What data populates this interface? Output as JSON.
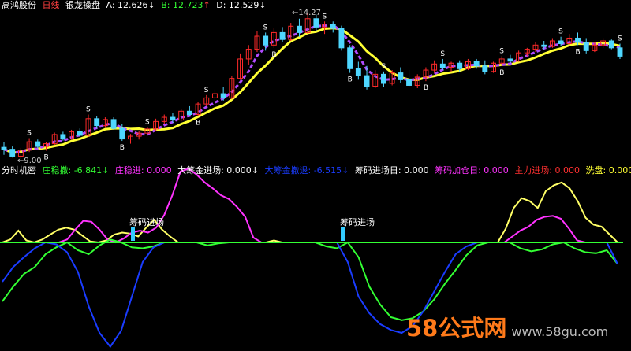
{
  "header": {
    "stock": "高鸿股份",
    "period": "日线",
    "indicator": "银龙操盘",
    "a_label": "A: 12.626",
    "a_arrow": "↓",
    "b_label": "B: 12.723",
    "b_arrow": "↑",
    "d_label": "D: 12.529",
    "d_arrow": "↓"
  },
  "annotations": {
    "high": "14.27",
    "low": "9.00",
    "sell": "S",
    "buy": "B"
  },
  "sub_header": {
    "name": "分时机密",
    "f1": "庄稳撤: -6.841",
    "f1_arrow": "↓",
    "f2": "庄稳进: 0.000",
    "f3": "大筹金进场: 0.000",
    "f3_arrow": "↓",
    "f4": "大筹金撤退: -6.515",
    "f4_arrow": "↓",
    "f5": "筹码进场日: 0.000",
    "f6": "筹码加仓日: 0.000",
    "f7": "主力进场: 0.000",
    "f8": "洗盘: 0.000",
    "f8_arrow": "↓"
  },
  "marker_label": "筹码进场",
  "watermark": {
    "big": "58公式网",
    "url": "www.58gu.com"
  },
  "colors": {
    "up": "#ff2a2a",
    "down": "#4fd7ff",
    "ma": "#ffff33",
    "purple": "#b04bff",
    "green": "#33ff33",
    "magenta": "#ff33ff",
    "yellow": "#ffff66",
    "blue": "#1a3cff",
    "cyan": "#33ccff"
  },
  "chart_data": [
    {
      "type": "candlestick",
      "title": "银龙操盘",
      "y_range": [
        9.0,
        14.27
      ],
      "labeled_high": 14.27,
      "labeled_low": 9.0,
      "candles": [
        [
          9.42,
          9.6,
          9.15,
          9.35
        ],
        [
          9.35,
          9.45,
          9.05,
          9.1
        ],
        [
          9.1,
          9.4,
          9.0,
          9.32
        ],
        [
          9.32,
          9.75,
          9.25,
          9.62
        ],
        [
          9.62,
          9.7,
          9.38,
          9.45
        ],
        [
          9.45,
          9.62,
          9.3,
          9.55
        ],
        [
          9.55,
          9.95,
          9.5,
          9.88
        ],
        [
          9.88,
          9.98,
          9.66,
          9.72
        ],
        [
          9.72,
          10.05,
          9.7,
          9.98
        ],
        [
          9.98,
          10.1,
          9.8,
          9.85
        ],
        [
          9.85,
          10.6,
          9.8,
          10.45
        ],
        [
          10.45,
          10.55,
          10.1,
          10.2
        ],
        [
          10.2,
          10.5,
          10.12,
          10.42
        ],
        [
          10.42,
          10.5,
          10.05,
          10.1
        ],
        [
          10.1,
          10.25,
          9.65,
          9.72
        ],
        [
          9.72,
          9.9,
          9.55,
          9.82
        ],
        [
          9.82,
          10.02,
          9.7,
          9.93
        ],
        [
          9.93,
          10.15,
          9.85,
          10.08
        ],
        [
          10.08,
          10.45,
          10.0,
          10.35
        ],
        [
          10.35,
          10.6,
          10.25,
          10.5
        ],
        [
          10.5,
          10.65,
          10.3,
          10.4
        ],
        [
          10.4,
          10.8,
          10.35,
          10.72
        ],
        [
          10.72,
          10.9,
          10.55,
          10.6
        ],
        [
          10.6,
          11.05,
          10.55,
          10.98
        ],
        [
          10.98,
          11.3,
          10.9,
          11.2
        ],
        [
          11.2,
          11.5,
          11.05,
          11.35
        ],
        [
          11.35,
          11.6,
          11.1,
          11.2
        ],
        [
          11.2,
          12.0,
          11.15,
          11.9
        ],
        [
          11.9,
          12.8,
          11.85,
          12.6
        ],
        [
          12.6,
          13.1,
          12.4,
          12.95
        ],
        [
          12.95,
          13.6,
          12.85,
          13.42
        ],
        [
          13.42,
          13.55,
          12.9,
          13.1
        ],
        [
          13.1,
          13.7,
          13.0,
          13.55
        ],
        [
          13.55,
          13.75,
          13.2,
          13.3
        ],
        [
          13.3,
          13.9,
          13.25,
          13.78
        ],
        [
          13.78,
          14.05,
          13.4,
          13.55
        ],
        [
          13.55,
          14.27,
          13.5,
          14.05
        ],
        [
          14.05,
          14.2,
          13.6,
          13.75
        ],
        [
          13.75,
          13.95,
          13.5,
          13.85
        ],
        [
          13.85,
          13.95,
          13.55,
          13.7
        ],
        [
          13.7,
          13.8,
          12.9,
          13.0
        ],
        [
          13.0,
          13.1,
          12.1,
          12.25
        ],
        [
          12.25,
          12.5,
          11.85,
          12.0
        ],
        [
          12.0,
          12.35,
          11.5,
          11.62
        ],
        [
          11.62,
          12.2,
          11.55,
          12.05
        ],
        [
          12.05,
          12.15,
          11.6,
          11.72
        ],
        [
          11.72,
          12.2,
          11.65,
          12.1
        ],
        [
          12.1,
          12.3,
          11.75,
          11.85
        ],
        [
          11.85,
          12.2,
          11.6,
          11.65
        ],
        [
          11.65,
          12.05,
          11.55,
          11.95
        ],
        [
          11.95,
          12.3,
          11.8,
          12.2
        ],
        [
          12.2,
          12.55,
          12.1,
          12.42
        ],
        [
          12.42,
          12.6,
          12.2,
          12.3
        ],
        [
          12.3,
          12.5,
          12.15,
          12.45
        ],
        [
          12.45,
          12.55,
          12.15,
          12.25
        ],
        [
          12.25,
          12.6,
          12.2,
          12.5
        ],
        [
          12.5,
          12.6,
          12.25,
          12.35
        ],
        [
          12.35,
          12.55,
          12.05,
          12.15
        ],
        [
          12.15,
          12.5,
          12.1,
          12.45
        ],
        [
          12.45,
          12.7,
          12.35,
          12.6
        ],
        [
          12.6,
          12.75,
          12.45,
          12.52
        ],
        [
          12.52,
          12.9,
          12.5,
          12.82
        ],
        [
          12.82,
          13.0,
          12.7,
          12.95
        ],
        [
          12.95,
          13.2,
          12.85,
          13.1
        ],
        [
          13.1,
          13.25,
          12.95,
          13.05
        ],
        [
          13.05,
          13.35,
          13.0,
          13.25
        ],
        [
          13.25,
          13.4,
          13.05,
          13.15
        ],
        [
          13.15,
          13.5,
          13.1,
          13.35
        ],
        [
          13.35,
          13.55,
          13.1,
          13.2
        ],
        [
          13.2,
          13.35,
          12.8,
          12.9
        ],
        [
          12.9,
          13.2,
          12.85,
          13.1
        ],
        [
          13.1,
          13.35,
          13.0,
          13.25
        ],
        [
          13.25,
          13.3,
          12.95,
          13.0
        ],
        [
          13.0,
          13.15,
          12.6,
          12.7
        ]
      ]
    },
    {
      "type": "line",
      "title": "分时机密",
      "series_note": "oscillator lines (values relative to zero line)",
      "series": [
        {
          "color": "yellow",
          "values": [
            0,
            0.3,
            1.2,
            0.2,
            0,
            0.3,
            0.8,
            1.3,
            1.5,
            1.3,
            0.7,
            0.1,
            0,
            0.2,
            0.8,
            1.0,
            0.9,
            0.6,
            1.5,
            2.3,
            1.3,
            0.6,
            0,
            0,
            0,
            0,
            0,
            0,
            0,
            0,
            0,
            0,
            0,
            0,
            0.2,
            0,
            0,
            0,
            0,
            0,
            0,
            0,
            0,
            0,
            0,
            0,
            0,
            0,
            0,
            0,
            0,
            0,
            0,
            0,
            0,
            0,
            0,
            0,
            0,
            0,
            0,
            0,
            0,
            1.4,
            3.5,
            4.5,
            4.2,
            3.5,
            5.2,
            5.8,
            6.1,
            5.5,
            4.2,
            2.5,
            1.8,
            1.6,
            0.8,
            0
          ]
        },
        {
          "color": "magenta",
          "values": [
            0,
            0,
            0,
            0,
            0,
            0,
            0,
            0,
            0.3,
            1.3,
            2.2,
            2.1,
            1.3,
            0.3,
            0,
            0.4,
            1.0,
            1.2,
            1.0,
            1.5,
            2.8,
            4.8,
            7.2,
            7.5,
            6.9,
            6.1,
            5.5,
            4.8,
            4.4,
            3.6,
            2.6,
            0.5,
            0,
            0,
            0,
            0,
            0,
            0,
            0,
            0,
            0,
            0,
            0,
            0,
            0,
            0,
            0,
            0,
            0,
            0,
            0,
            0,
            0,
            0,
            0,
            0,
            0,
            0,
            0,
            0,
            0,
            0,
            0,
            0.6,
            1.2,
            1.6,
            2.3,
            2.6,
            2.7,
            2.4,
            1.4,
            0.2,
            0,
            0,
            0,
            0,
            0
          ]
        },
        {
          "color": "green",
          "values": [
            -6,
            -4.5,
            -3.2,
            -2.5,
            -1.2,
            -0.5,
            0,
            -0.8,
            -1.2,
            -0.3,
            0.3,
            0,
            -0.5,
            -0.6,
            -0.4,
            0,
            0,
            0,
            0,
            -0.3,
            -0.1,
            0,
            0,
            0,
            0,
            0,
            0,
            0,
            0,
            0,
            -0.4,
            -0.6,
            0,
            -1.5,
            -4.5,
            -6.3,
            -7.6,
            -7.9,
            -7.7,
            -7.0,
            -5.8,
            -4.2,
            -2.8,
            -1.3,
            -0.3,
            0,
            0,
            0,
            -0.6,
            -0.9,
            -0.7,
            -0.2,
            0,
            -0.6,
            -1.0,
            -1.1,
            -0.8,
            -2.2
          ]
        },
        {
          "color": "blue",
          "values": [
            -4,
            -2.5,
            -1.5,
            -0.6,
            0,
            -0.2,
            -1.0,
            -3.0,
            -6.5,
            -9.2,
            -10.6,
            -9.0,
            -5.5,
            -2.0,
            -0.5,
            0,
            0,
            0,
            0,
            0,
            0,
            0,
            0,
            0,
            0,
            0,
            0,
            0,
            0,
            0,
            0,
            0,
            -2.0,
            -5.5,
            -7.2,
            -8.3,
            -8.9,
            -9.2,
            -8.5,
            -7.0,
            -5.0,
            -3.0,
            -1.2,
            -0.4,
            0,
            0,
            0,
            0,
            0,
            0,
            0,
            0,
            0,
            0,
            0,
            0,
            0,
            -2.2
          ]
        }
      ],
      "markers": [
        "筹码进场",
        "筹码进场"
      ]
    }
  ]
}
